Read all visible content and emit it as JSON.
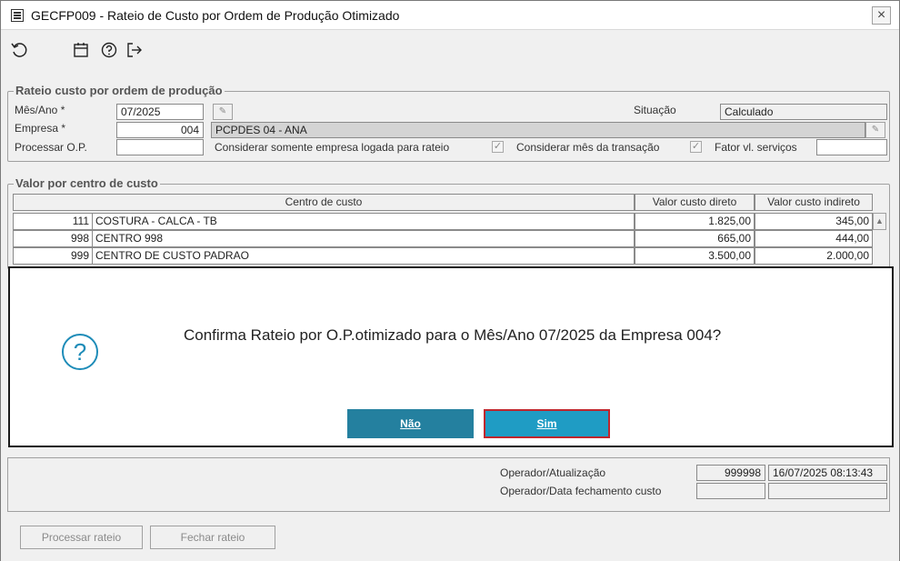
{
  "window": {
    "title": "GECFP009 - Rateio de Custo por Ordem de Produção Otimizado",
    "close_glyph": "×"
  },
  "toolbar": {
    "icons": [
      "refresh-icon",
      "calendar-icon",
      "help-icon",
      "exit-icon"
    ]
  },
  "rateio": {
    "legend": "Rateio custo por ordem de produção",
    "mes_ano_label": "Mês/Ano *",
    "mes_ano_value": "07/2025",
    "empresa_label": "Empresa *",
    "empresa_value": "004",
    "empresa_name": "PCPDES 04 - ANA",
    "processar_op_label": "Processar O.P.",
    "processar_op_value": "",
    "situacao_label": "Situação",
    "situacao_value": "Calculado",
    "somente_empresa_label": "Considerar somente empresa logada para rateio",
    "mes_transacao_label": "Considerar mês da transação",
    "fator_label": "Fator vl. serviços",
    "fator_value": ""
  },
  "centro": {
    "legend": "Valor por centro de custo",
    "columns": [
      "Centro de custo",
      "Valor custo direto",
      "Valor custo indireto"
    ],
    "rows": [
      {
        "code": "111",
        "name": "COSTURA - CALCA - TB",
        "direto": "1.825,00",
        "indireto": "345,00"
      },
      {
        "code": "998",
        "name": "CENTRO 998",
        "direto": "665,00",
        "indireto": "444,00"
      },
      {
        "code": "999",
        "name": "CENTRO DE CUSTO PADRAO",
        "direto": "3.500,00",
        "indireto": "2.000,00"
      }
    ]
  },
  "footer": {
    "operador_label": "Operador/Atualização",
    "operador_code": "999998",
    "operador_datetime": "16/07/2025 08:13:43",
    "fechamento_label": "Operador/Data fechamento custo",
    "fechamento_code": "",
    "fechamento_date": ""
  },
  "actions": {
    "processar": "Processar rateio",
    "fechar": "Fechar rateio"
  },
  "dialog": {
    "message": "Confirma Rateio por O.P.otimizado para o Mês/Ano 07/2025 da Empresa 004?",
    "icon_glyph": "?",
    "no_label": "Não",
    "yes_label": "Sim"
  }
}
